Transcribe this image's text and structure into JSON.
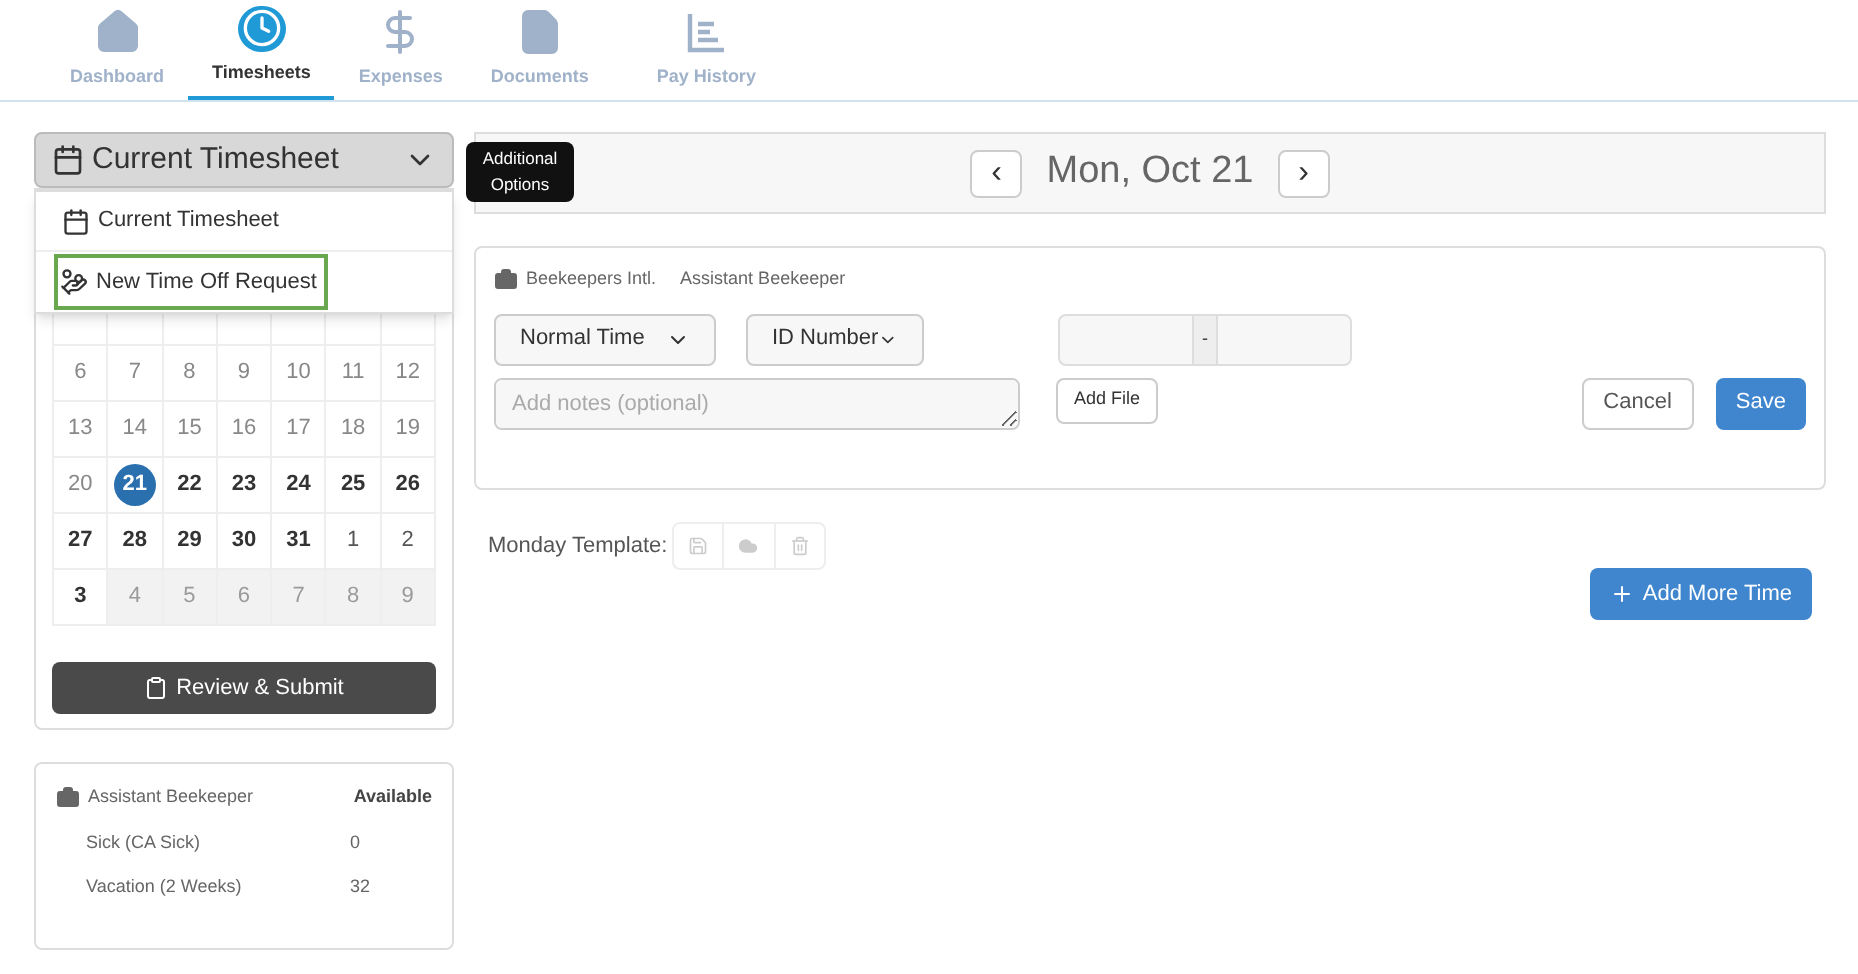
{
  "nav": [
    {
      "label": "Dashboard",
      "selected": false
    },
    {
      "label": "Timesheets",
      "selected": true
    },
    {
      "label": "Expenses",
      "selected": false
    },
    {
      "label": "Documents",
      "selected": false
    },
    {
      "label": "Pay History",
      "selected": false
    }
  ],
  "timesheet_select": {
    "value": "Current Timesheet",
    "expanded": true
  },
  "dropdown_menu": [
    {
      "label": "Current Timesheet",
      "selected": false
    },
    {
      "label": "New Time Off Request",
      "selected": true
    }
  ],
  "tooltip": "Additional Options",
  "calendar": {
    "weeks": [
      [
        {
          "day": "6",
          "kind": "past"
        },
        {
          "day": "7",
          "kind": "past"
        },
        {
          "day": "8",
          "kind": "past"
        },
        {
          "day": "9",
          "kind": "past"
        },
        {
          "day": "10",
          "kind": "past"
        },
        {
          "day": "11",
          "kind": "past"
        },
        {
          "day": "12",
          "kind": "past"
        }
      ],
      [
        {
          "day": "13",
          "kind": "past"
        },
        {
          "day": "14",
          "kind": "past"
        },
        {
          "day": "15",
          "kind": "past"
        },
        {
          "day": "16",
          "kind": "past"
        },
        {
          "day": "17",
          "kind": "past"
        },
        {
          "day": "18",
          "kind": "past"
        },
        {
          "day": "19",
          "kind": "past"
        }
      ],
      [
        {
          "day": "20",
          "kind": "past"
        },
        {
          "day": "21",
          "kind": "active",
          "selected": true
        },
        {
          "day": "22",
          "kind": "active"
        },
        {
          "day": "23",
          "kind": "active"
        },
        {
          "day": "24",
          "kind": "active"
        },
        {
          "day": "25",
          "kind": "active"
        },
        {
          "day": "26",
          "kind": "active"
        }
      ],
      [
        {
          "day": "27",
          "kind": "active"
        },
        {
          "day": "28",
          "kind": "active"
        },
        {
          "day": "29",
          "kind": "active"
        },
        {
          "day": "30",
          "kind": "active"
        },
        {
          "day": "31",
          "kind": "active"
        },
        {
          "day": "1",
          "kind": "outside"
        },
        {
          "day": "2",
          "kind": "outside"
        }
      ],
      [
        {
          "day": "3",
          "kind": "active"
        },
        {
          "day": "4",
          "kind": "disabled"
        },
        {
          "day": "5",
          "kind": "disabled"
        },
        {
          "day": "6",
          "kind": "disabled"
        },
        {
          "day": "7",
          "kind": "disabled"
        },
        {
          "day": "8",
          "kind": "disabled"
        },
        {
          "day": "9",
          "kind": "disabled"
        }
      ]
    ]
  },
  "review_button": "Review & Submit",
  "balances": {
    "job": "Assistant Beekeeper",
    "heading": "Available",
    "rows": [
      {
        "name": "Sick (CA Sick)",
        "value": "0"
      },
      {
        "name": "Vacation (2 Weeks)",
        "value": "32"
      }
    ]
  },
  "date_nav": {
    "prev": "‹",
    "date": "Mon, Oct 21",
    "next": "›"
  },
  "entry": {
    "company": "Beekeepers Intl.",
    "position": "Assistant Beekeeper",
    "time_type": "Normal Time",
    "id_select": "ID Number",
    "range_separator": "-",
    "notes_placeholder": "Add notes (optional)",
    "add_file": "Add File",
    "cancel": "Cancel",
    "save": "Save"
  },
  "template": {
    "label": "Monday Template:"
  },
  "add_more_time": "Add More Time"
}
